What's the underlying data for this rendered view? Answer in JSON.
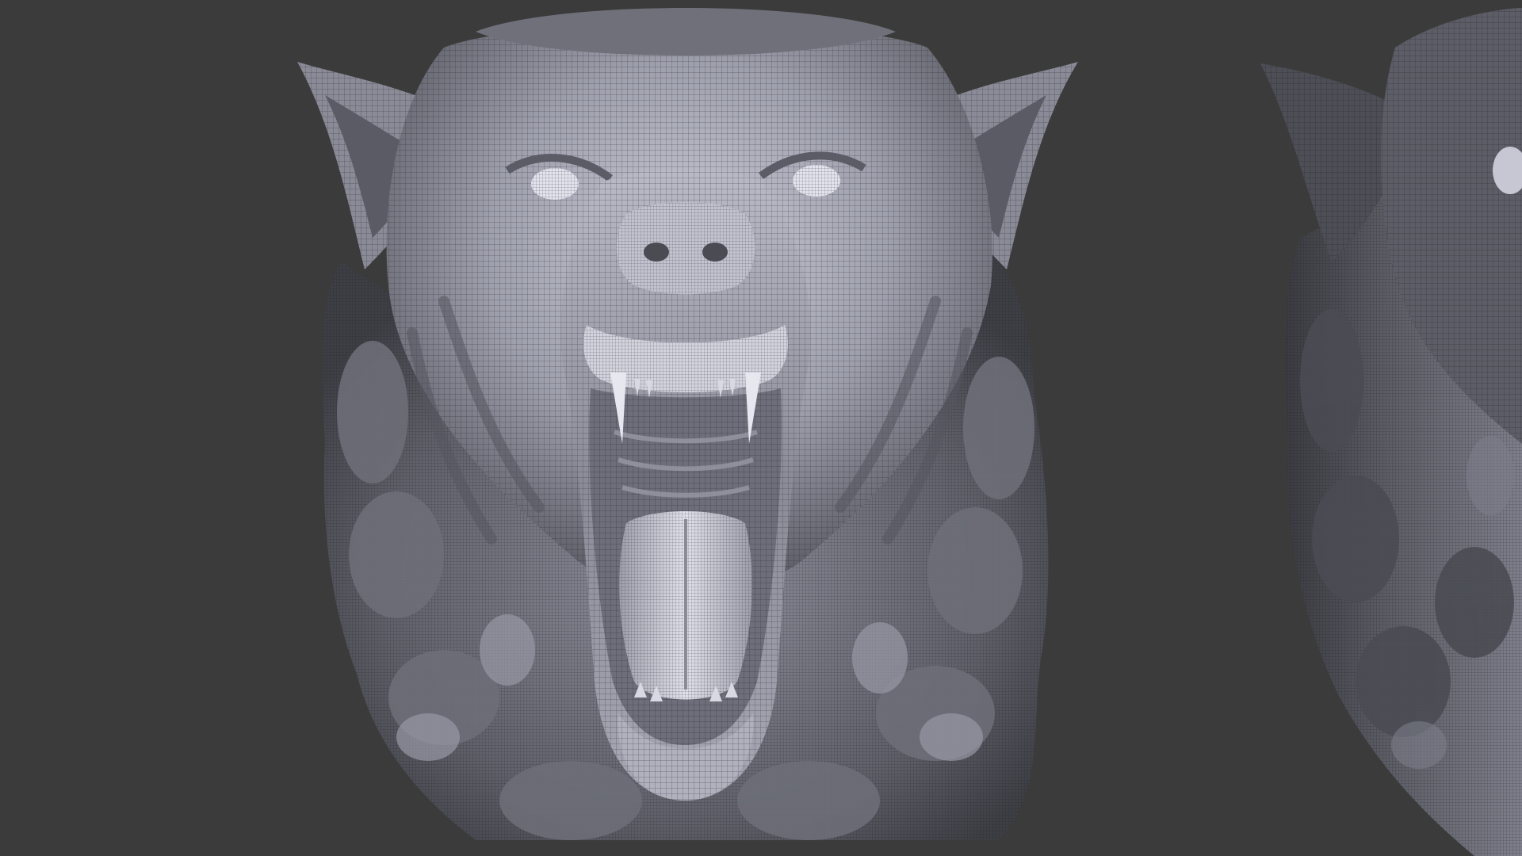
{
  "scene": {
    "background_color": "#3b3b3b",
    "mesh_color_light": "#cfd0dc",
    "mesh_color_mid": "#8c8d99",
    "mesh_color_dark": "#2b2b30",
    "wire_color": "#1e1e24",
    "subjects": [
      {
        "kind": "wolf-head-mesh-front-view"
      },
      {
        "kind": "wolf-head-mesh-side-view-cropped"
      }
    ]
  }
}
